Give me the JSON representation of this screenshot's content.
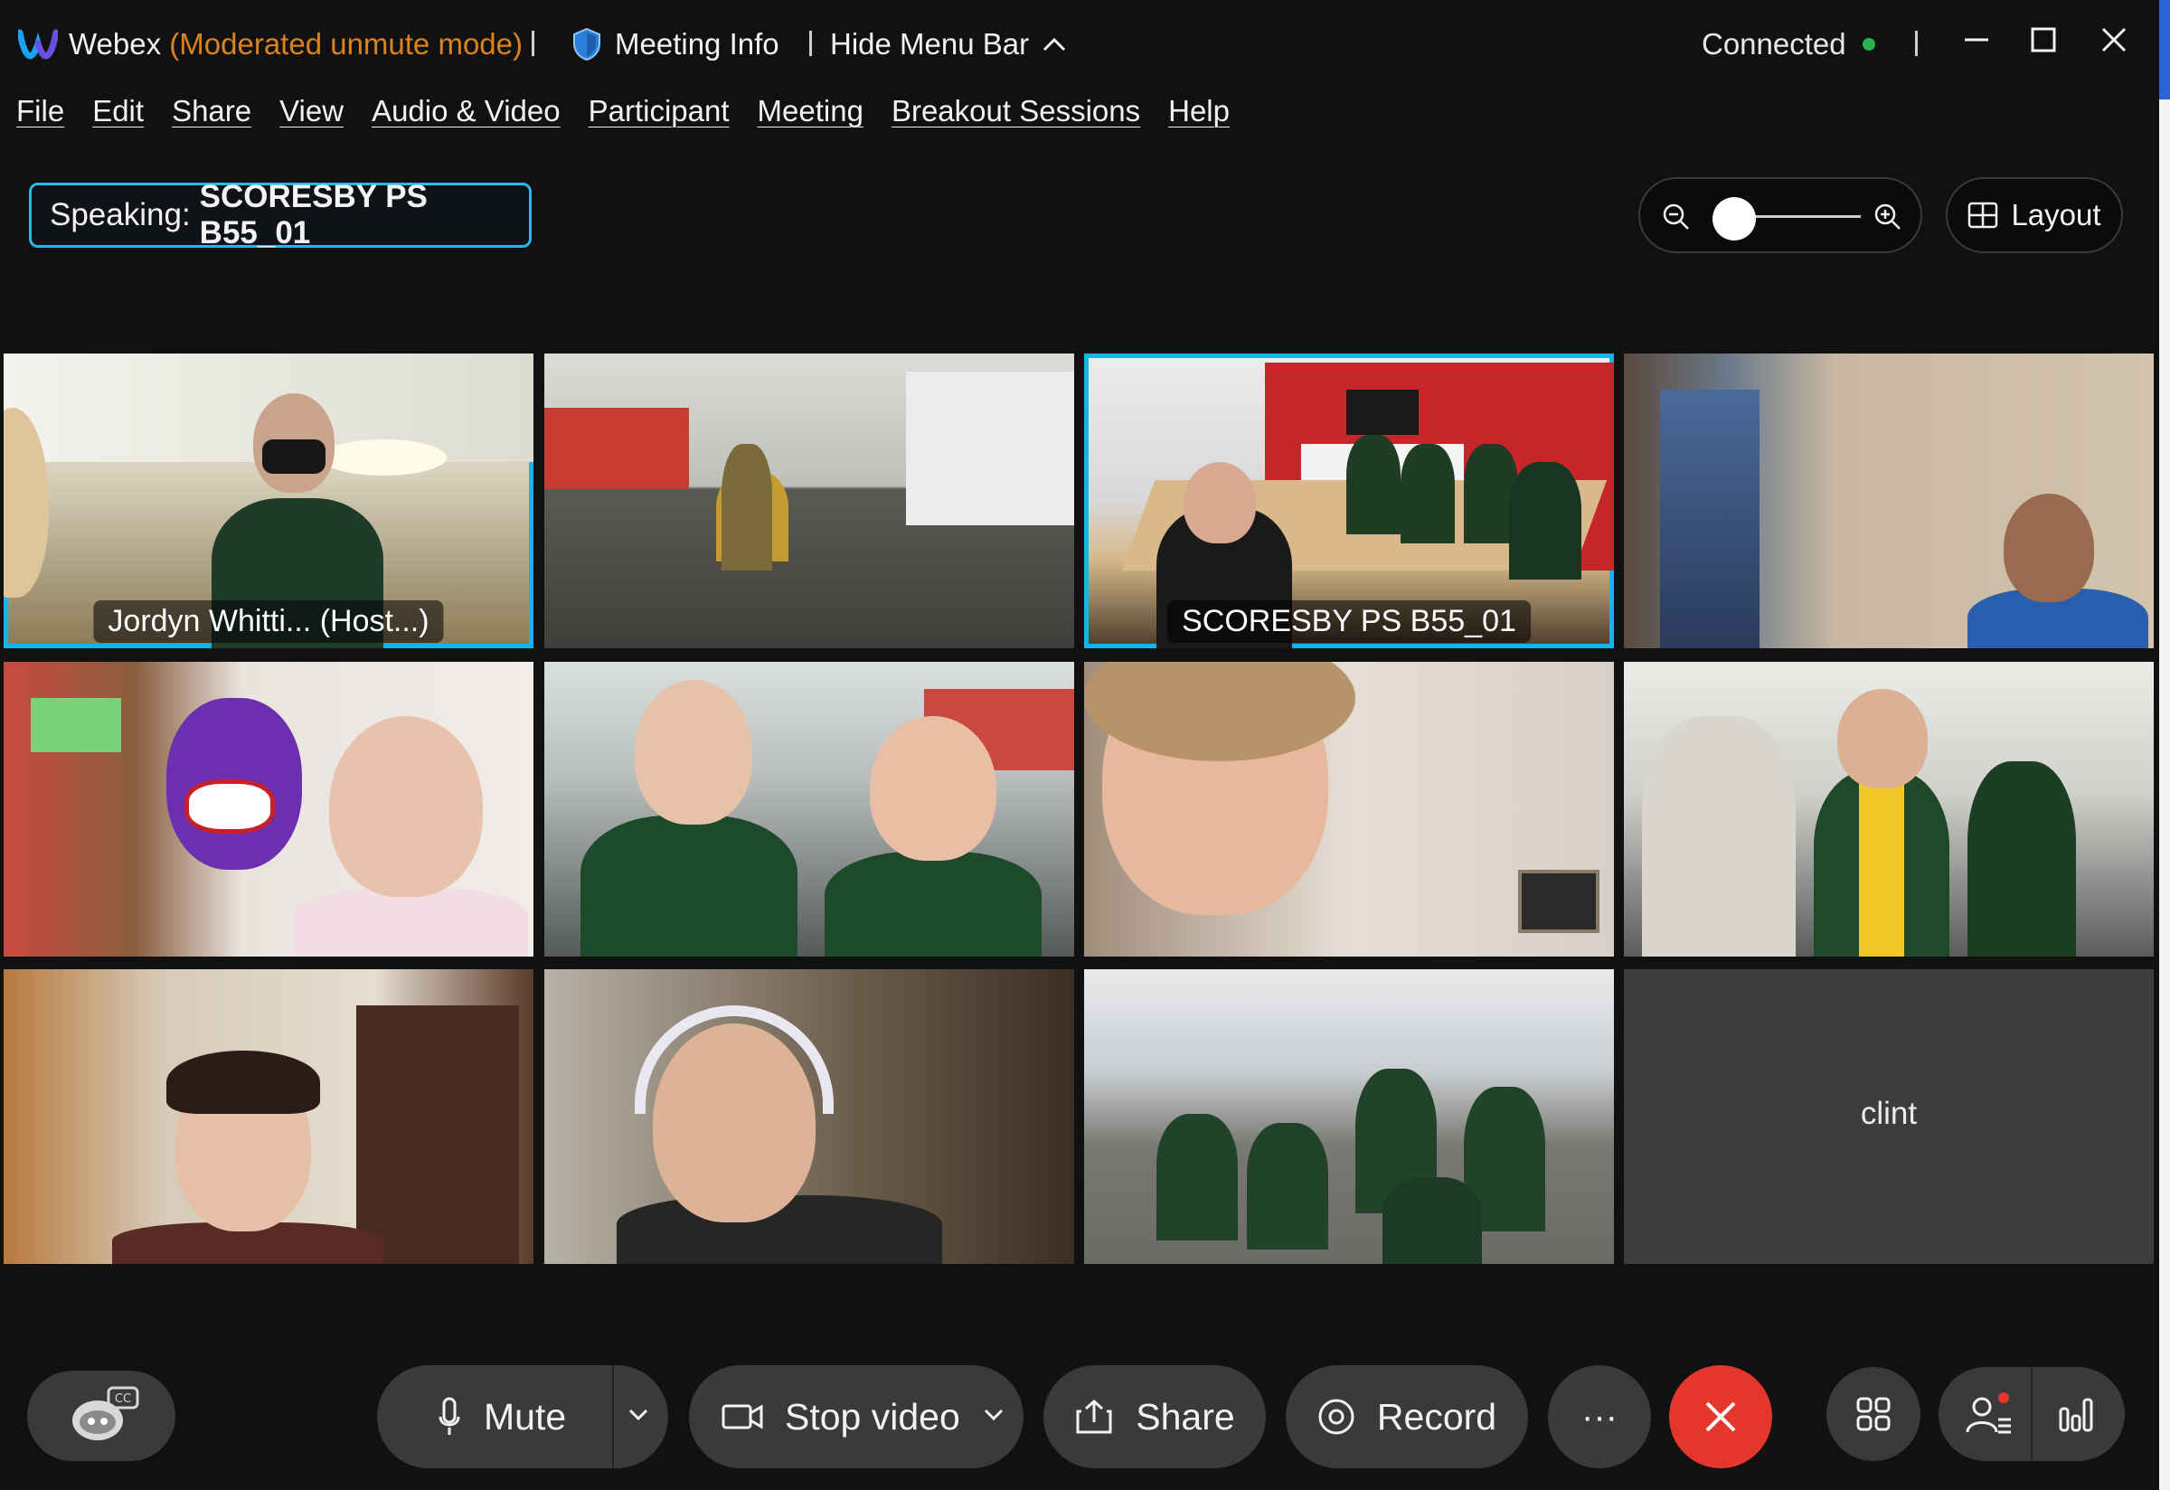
{
  "titlebar": {
    "app_name": "Webex",
    "mode_label": "(Moderated unmute mode)",
    "meeting_info_label": "Meeting Info",
    "hide_menu_label": "Hide Menu Bar",
    "status_label": "Connected",
    "status_color": "#2bb24c"
  },
  "menu": {
    "items": [
      {
        "label": "File"
      },
      {
        "label": "Edit"
      },
      {
        "label": "Share"
      },
      {
        "label": "View"
      },
      {
        "label": "Audio & Video"
      },
      {
        "label": "Participant"
      },
      {
        "label": "Meeting"
      },
      {
        "label": "Breakout Sessions"
      },
      {
        "label": "Help"
      }
    ]
  },
  "speaking": {
    "prefix": "Speaking:",
    "name": "SCORESBY PS B55_01"
  },
  "view_controls": {
    "layout_label": "Layout"
  },
  "video_tiles": [
    {
      "label": "Jordyn Whitti... (Host...)",
      "active": true
    },
    {
      "label": "",
      "active": false
    },
    {
      "label": "SCORESBY PS B55_01",
      "active": true
    },
    {
      "label": "",
      "active": false
    },
    {
      "label": "",
      "active": false
    },
    {
      "label": "",
      "active": false
    },
    {
      "label": "",
      "active": false
    },
    {
      "label": "",
      "active": false
    },
    {
      "label": "",
      "active": false
    },
    {
      "label": "",
      "active": false
    },
    {
      "label": "",
      "active": false
    },
    {
      "label": "clint",
      "active": false
    }
  ],
  "controls": {
    "mute_label": "Mute",
    "stop_video_label": "Stop video",
    "share_label": "Share",
    "record_label": "Record",
    "more_label": "···",
    "end_color": "#e5362b",
    "accent_color": "#17b4ea"
  }
}
